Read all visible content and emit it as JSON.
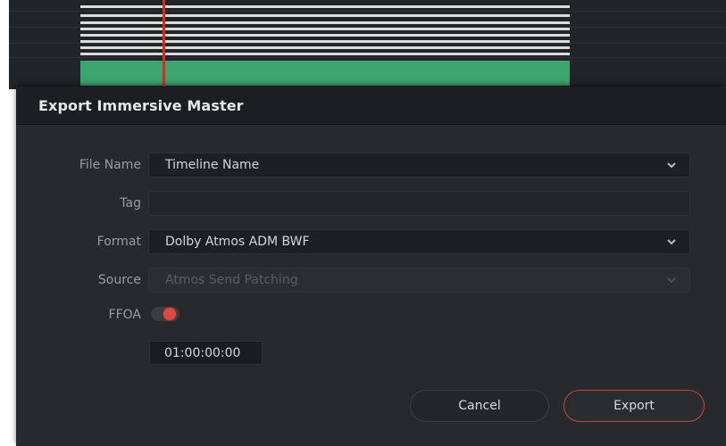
{
  "dialog": {
    "title": "Export Immersive Master"
  },
  "form": {
    "file_name": {
      "label": "File Name",
      "value": "Timeline Name",
      "icon": "chevron-down-icon"
    },
    "tag": {
      "label": "Tag",
      "value": ""
    },
    "format": {
      "label": "Format",
      "value": "Dolby Atmos ADM BWF",
      "icon": "chevron-down-icon"
    },
    "source": {
      "label": "Source",
      "value": "Atmos Send Patching",
      "disabled": true,
      "icon": "chevron-down-icon"
    },
    "ffoa": {
      "label": "FFOA",
      "toggle_on": true,
      "timecode": "01:00:00:00"
    }
  },
  "buttons": {
    "cancel": "Cancel",
    "export": "Export"
  },
  "colors": {
    "clip": "#3da56e",
    "playhead": "#b83a2e",
    "toggle_active": "#e04a3c",
    "export_border": "#c4473c"
  }
}
